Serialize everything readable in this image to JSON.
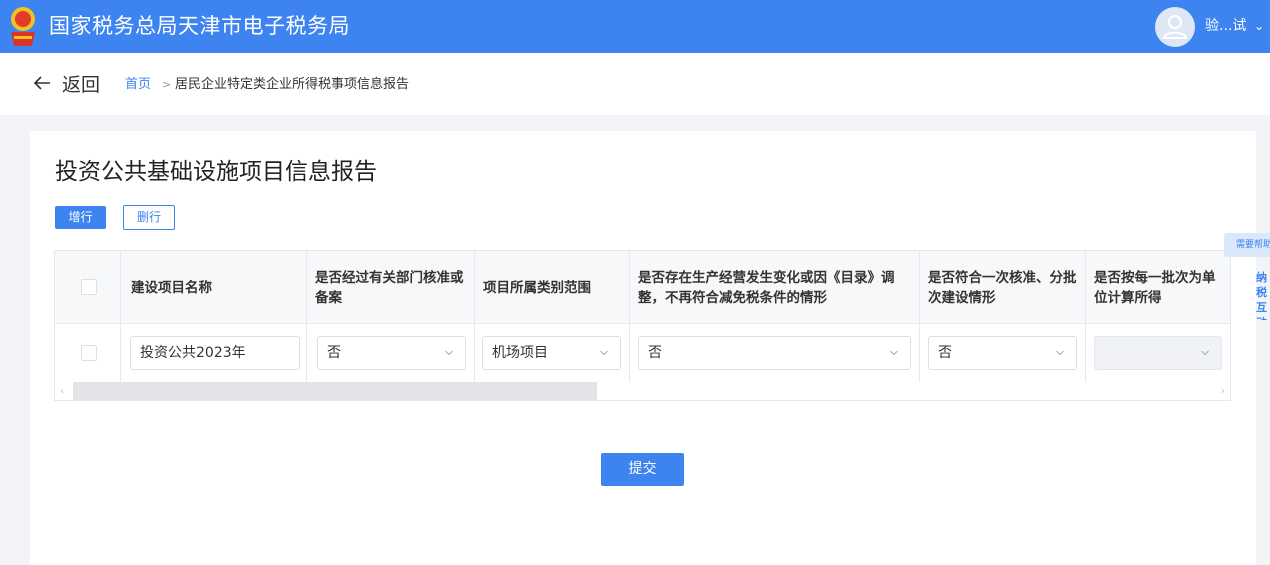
{
  "header": {
    "title": "国家税务总局天津市电子税务局",
    "user_name": "验...试",
    "logo_icon": "tax-emblem-icon",
    "brand_color": "#3d84f0"
  },
  "breadcrumb": {
    "back_label": "返回",
    "home": "首页",
    "separator": ">",
    "current": "居民企业特定类企业所得税事项信息报告"
  },
  "main": {
    "title": "投资公共基础设施项目信息报告",
    "add_row_label": "增行",
    "delete_row_label": "删行",
    "submit_label": "提交"
  },
  "table": {
    "headers": [
      "建设项目名称",
      "是否经过有关部门核准或备案",
      "项目所属类别范围",
      "是否存在生产经营发生变化或因《目录》调整，不再符合减免税条件的情形",
      "是否符合一次核准、分批次建设情形",
      "是否按每一批次为单位计算所得"
    ],
    "rows": [
      {
        "project_name": "投资公共2023年",
        "approved": "否",
        "category": "机场项目",
        "changed": "否",
        "batch_build": "否",
        "per_batch": ""
      }
    ]
  },
  "help": {
    "tab_label": "需要帮助",
    "float_text": "纳税互动"
  }
}
